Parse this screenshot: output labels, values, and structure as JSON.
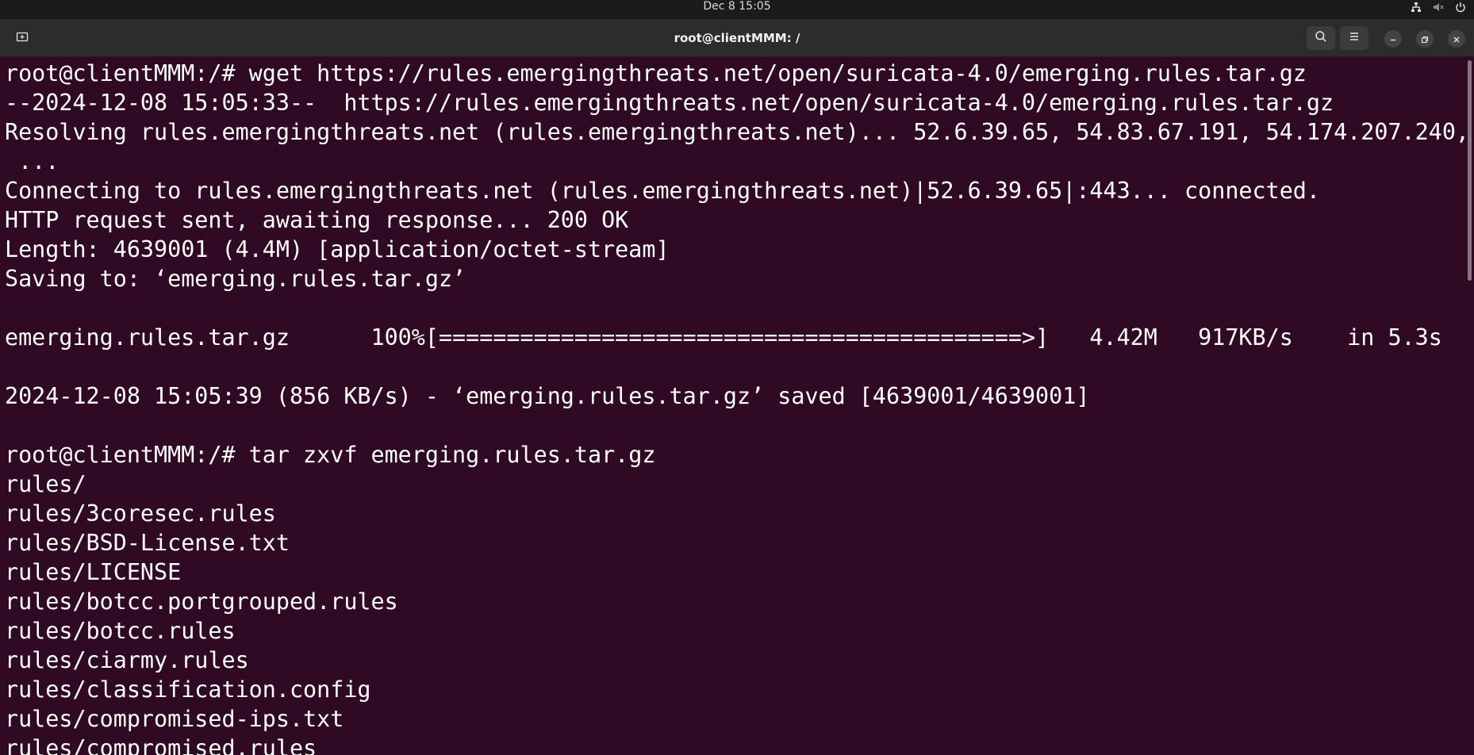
{
  "topbar": {
    "clock": "Dec 8  15:05",
    "icons": [
      "network-icon",
      "volume-muted-icon",
      "power-icon"
    ]
  },
  "window": {
    "title": "root@clientMMM: /",
    "new_tab_icon": "new-tab-icon",
    "search_icon": "search-icon",
    "menu_icon": "hamburger-menu-icon",
    "minimize_icon": "minimize-icon",
    "restore_icon": "restore-icon",
    "close_icon": "close-icon"
  },
  "colors": {
    "terminal_bg": "#300a24",
    "terminal_fg": "#ffffff",
    "headerbar_bg": "#2c2c2c",
    "topbar_bg": "#1b1b1b"
  },
  "terminal": {
    "lines": [
      "root@clientMMM:/# wget https://rules.emergingthreats.net/open/suricata-4.0/emerging.rules.tar.gz",
      "--2024-12-08 15:05:33--  https://rules.emergingthreats.net/open/suricata-4.0/emerging.rules.tar.gz",
      "Resolving rules.emergingthreats.net (rules.emergingthreats.net)... 52.6.39.65, 54.83.67.191, 54.174.207.240,",
      " ...",
      "Connecting to rules.emergingthreats.net (rules.emergingthreats.net)|52.6.39.65|:443... connected.",
      "HTTP request sent, awaiting response... 200 OK",
      "Length: 4639001 (4.4M) [application/octet-stream]",
      "Saving to: ‘emerging.rules.tar.gz’",
      "",
      "emerging.rules.tar.gz      100%[===========================================>]   4.42M   917KB/s    in 5.3s",
      "",
      "2024-12-08 15:05:39 (856 KB/s) - ‘emerging.rules.tar.gz’ saved [4639001/4639001]",
      "",
      "root@clientMMM:/# tar zxvf emerging.rules.tar.gz",
      "rules/",
      "rules/3coresec.rules",
      "rules/BSD-License.txt",
      "rules/LICENSE",
      "rules/botcc.portgrouped.rules",
      "rules/botcc.rules",
      "rules/ciarmy.rules",
      "rules/classification.config",
      "rules/compromised-ips.txt",
      "rules/compromised.rules"
    ]
  }
}
